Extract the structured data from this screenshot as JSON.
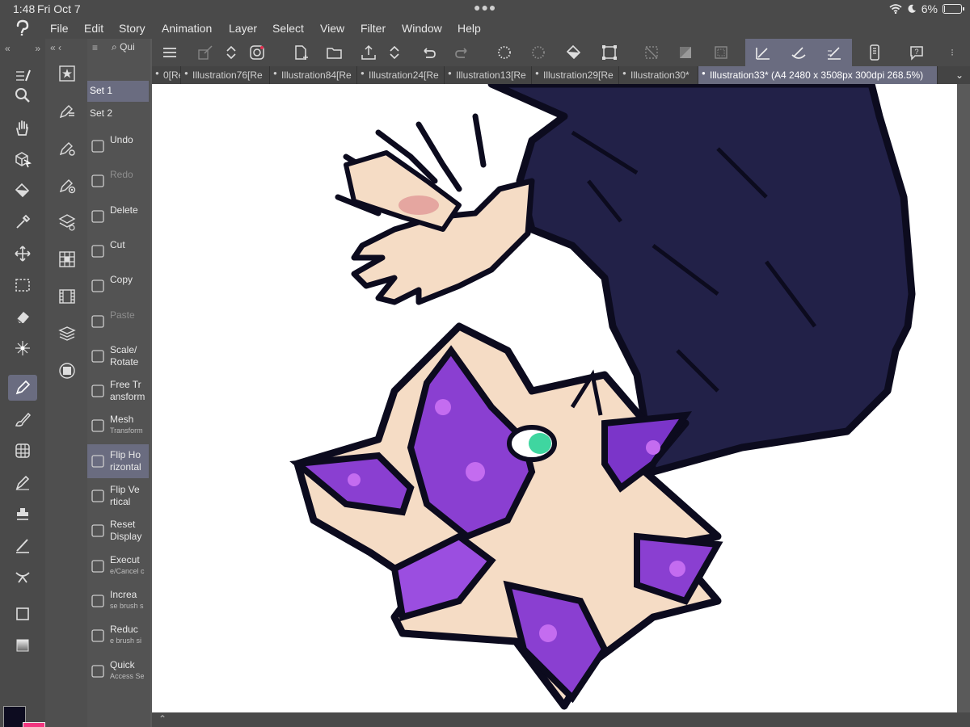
{
  "status": {
    "time": "1:48",
    "date": "Fri Oct 7",
    "battery_label": "6%",
    "battery_level": 0.06
  },
  "menu": {
    "items": [
      "File",
      "Edit",
      "Story",
      "Animation",
      "Layer",
      "Select",
      "View",
      "Filter",
      "Window",
      "Help"
    ]
  },
  "tools": [
    "search-icon",
    "hand-icon",
    "cube-select-icon",
    "fill-icon",
    "eyedropper-icon",
    "move-icon",
    "marquee-icon",
    "eraser-icon",
    "magic-wand-icon",
    "pen-icon",
    "brush-icon",
    "grid-icon",
    "pencil-icon",
    "stamp-icon",
    "stroke-icon",
    "sparkle-icon",
    "rectangle-icon",
    "gradient-icon"
  ],
  "quick_access": {
    "tab_label": "Qui",
    "sets": [
      "Set 1",
      "Set 2"
    ],
    "items": [
      {
        "label": "Undo",
        "sub": "",
        "dim": false
      },
      {
        "label": "Redo",
        "sub": "",
        "dim": true
      },
      {
        "label": "Delete",
        "sub": "",
        "dim": false
      },
      {
        "label": "Cut",
        "sub": "",
        "dim": false
      },
      {
        "label": "Copy",
        "sub": "",
        "dim": false
      },
      {
        "label": "Paste",
        "sub": "",
        "dim": true
      },
      {
        "label": "Scale/ Rotate",
        "sub": "",
        "dim": false
      },
      {
        "label": "Free Tr ansform",
        "sub": "",
        "dim": false
      },
      {
        "label": "Mesh",
        "sub": "Transform",
        "dim": false
      },
      {
        "label": "Flip Ho rizontal",
        "sub": "",
        "dim": false,
        "active": true
      },
      {
        "label": "Flip Ve rtical",
        "sub": "",
        "dim": false
      },
      {
        "label": "Reset Display",
        "sub": "",
        "dim": false
      },
      {
        "label": "Execut",
        "sub": "e/Cancel c",
        "dim": false
      },
      {
        "label": "Increa",
        "sub": "se brush s",
        "dim": false
      },
      {
        "label": "Reduc",
        "sub": "e brush si",
        "dim": false
      },
      {
        "label": "Quick",
        "sub": "Access Se",
        "dim": false
      }
    ]
  },
  "tabs": [
    {
      "label": "0[Re",
      "active": false
    },
    {
      "label": "Illustration76[Re",
      "active": false
    },
    {
      "label": "Illustration84[Re",
      "active": false
    },
    {
      "label": "Illustration24[Re",
      "active": false
    },
    {
      "label": "Illustration13[Re",
      "active": false
    },
    {
      "label": "Illustration29[Re",
      "active": false
    },
    {
      "label": "Illustration30*",
      "active": false
    },
    {
      "label": "Illustration33* (A4 2480 x 3508px 300dpi 268.5%)",
      "active": true
    }
  ],
  "colors": {
    "main": "#0d0c20",
    "sub": "#f2357f",
    "accent": "#6a6c80"
  }
}
